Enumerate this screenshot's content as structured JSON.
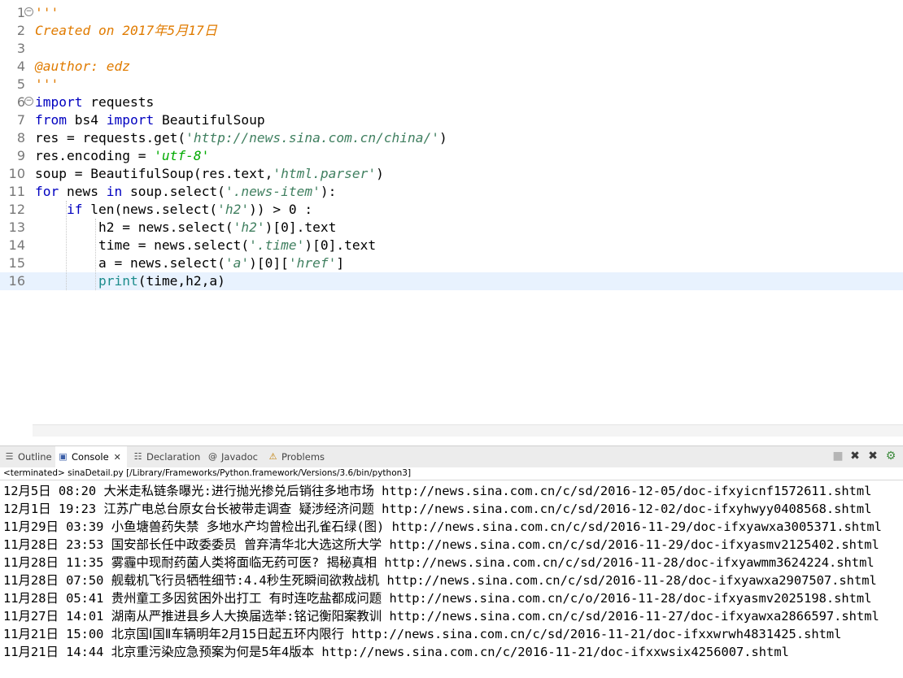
{
  "editor": {
    "lines": [
      {
        "num": "1",
        "fold": "−",
        "segs": [
          {
            "t": "'''",
            "c": "doc"
          }
        ]
      },
      {
        "num": "2",
        "segs": [
          {
            "t": "Created on 2017年5月17日",
            "c": "doc"
          }
        ]
      },
      {
        "num": "3",
        "segs": []
      },
      {
        "num": "4",
        "segs": [
          {
            "t": "@author: ",
            "c": "doc"
          },
          {
            "t": "edz",
            "c": "doc"
          }
        ]
      },
      {
        "num": "5",
        "segs": [
          {
            "t": "'''",
            "c": "doc"
          }
        ]
      },
      {
        "num": "6",
        "fold": "−",
        "segs": [
          {
            "t": "import",
            "c": "kw"
          },
          {
            "t": " requests",
            "c": ""
          }
        ]
      },
      {
        "num": "7",
        "segs": [
          {
            "t": "from",
            "c": "kw"
          },
          {
            "t": " bs4 ",
            "c": ""
          },
          {
            "t": "import",
            "c": "kw"
          },
          {
            "t": " BeautifulSoup",
            "c": ""
          }
        ]
      },
      {
        "num": "8",
        "segs": [
          {
            "t": "res = requests.get(",
            "c": ""
          },
          {
            "t": "'http://news.sina.com.cn/china/'",
            "c": "str"
          },
          {
            "t": ")",
            "c": ""
          }
        ]
      },
      {
        "num": "9",
        "segs": [
          {
            "t": "res.encoding = ",
            "c": ""
          },
          {
            "t": "'utf-8'",
            "c": "str2"
          }
        ]
      },
      {
        "num": "10",
        "segs": [
          {
            "t": "soup = BeautifulSoup(res.text,",
            "c": ""
          },
          {
            "t": "'html.parser'",
            "c": "str"
          },
          {
            "t": ")",
            "c": ""
          }
        ]
      },
      {
        "num": "11",
        "segs": [
          {
            "t": "for",
            "c": "kw"
          },
          {
            "t": " news ",
            "c": ""
          },
          {
            "t": "in",
            "c": "kw"
          },
          {
            "t": " soup.select(",
            "c": ""
          },
          {
            "t": "'.news-item'",
            "c": "str"
          },
          {
            "t": "):",
            "c": ""
          }
        ]
      },
      {
        "num": "12",
        "segs": [
          {
            "t": "    ",
            "c": ""
          },
          {
            "t": "if",
            "c": "kw"
          },
          {
            "t": " len(news.select(",
            "c": ""
          },
          {
            "t": "'h2'",
            "c": "str"
          },
          {
            "t": ")) > 0 :",
            "c": ""
          }
        ]
      },
      {
        "num": "13",
        "segs": [
          {
            "t": "        h2 = news.select(",
            "c": ""
          },
          {
            "t": "'h2'",
            "c": "str"
          },
          {
            "t": ")[0].text",
            "c": ""
          }
        ]
      },
      {
        "num": "14",
        "segs": [
          {
            "t": "        time = news.select(",
            "c": ""
          },
          {
            "t": "'.time'",
            "c": "str"
          },
          {
            "t": ")[0].text",
            "c": ""
          }
        ]
      },
      {
        "num": "15",
        "segs": [
          {
            "t": "        a = news.select(",
            "c": ""
          },
          {
            "t": "'a'",
            "c": "str"
          },
          {
            "t": ")[0][",
            "c": ""
          },
          {
            "t": "'href'",
            "c": "str"
          },
          {
            "t": "]",
            "c": ""
          }
        ]
      },
      {
        "num": "16",
        "current": true,
        "segs": [
          {
            "t": "        ",
            "c": ""
          },
          {
            "t": "print",
            "c": "builtin"
          },
          {
            "t": "(time,h2,a)",
            "c": ""
          }
        ]
      }
    ]
  },
  "tabs": [
    {
      "label": "Outline",
      "icon": "outline-icon",
      "glyph": "☰"
    },
    {
      "label": "Console",
      "icon": "console-icon",
      "glyph": "▣",
      "active": true,
      "close": "✕"
    },
    {
      "label": "Declaration",
      "icon": "declaration-icon",
      "glyph": "☷"
    },
    {
      "label": "Javadoc",
      "icon": "javadoc-icon",
      "glyph": "@"
    },
    {
      "label": "Problems",
      "icon": "problems-icon",
      "glyph": "⚠"
    }
  ],
  "console_status": "<terminated> sinaDetail.py [/Library/Frameworks/Python.framework/Versions/3.6/bin/python3]",
  "console_output": [
    "12月5日 08:20 大米走私链条曝光:进行抛光掺兑后销往多地市场 http://news.sina.com.cn/c/sd/2016-12-05/doc-ifxyicnf1572611.shtml",
    "12月1日 19:23 江苏广电总台原女台长被带走调查 疑涉经济问题 http://news.sina.com.cn/c/sd/2016-12-02/doc-ifxyhwyy0408568.shtml",
    "11月29日 03:39 小鱼塘兽药失禁 多地水产均曾检出孔雀石绿(图) http://news.sina.com.cn/c/sd/2016-11-29/doc-ifxyawxa3005371.shtml",
    "11月28日 23:53 国安部长任中政委委员 曾弃清华北大选这所大学 http://news.sina.com.cn/c/sd/2016-11-29/doc-ifxyasmv2125402.shtml",
    "11月28日 11:35 雾霾中现耐药菌人类将面临无药可医? 揭秘真相 http://news.sina.com.cn/c/sd/2016-11-28/doc-ifxyawmm3624224.shtml",
    "11月28日 07:50 舰载机飞行员牺牲细节:4.4秒生死瞬间欲救战机 http://news.sina.com.cn/c/sd/2016-11-28/doc-ifxyawxa2907507.shtml",
    "11月28日 05:41 贵州童工多因贫困外出打工 有时连吃盐都成问题 http://news.sina.com.cn/c/o/2016-11-28/doc-ifxyasmv2025198.shtml",
    "11月27日 14:01 湖南从严推进县乡人大换届选举:铭记衡阳案教训 http://news.sina.com.cn/c/sd/2016-11-27/doc-ifxyawxa2866597.shtml",
    "11月21日 15:00 北京国Ⅰ国Ⅱ车辆明年2月15日起五环内限行 http://news.sina.com.cn/c/sd/2016-11-21/doc-ifxxwrwh4831425.shtml",
    "11月21日 14:44 北京重污染应急预案为何是5年4版本 http://news.sina.com.cn/c/2016-11-21/doc-ifxxwsix4256007.shtml"
  ],
  "toolbar": [
    {
      "icon": "minimize-icon",
      "glyph": "■"
    },
    {
      "icon": "remove-launch-icon",
      "glyph": "✖"
    },
    {
      "icon": "remove-all-terminated-icon",
      "glyph": "✖"
    },
    {
      "icon": "debug-icon",
      "glyph": "⚙"
    }
  ]
}
